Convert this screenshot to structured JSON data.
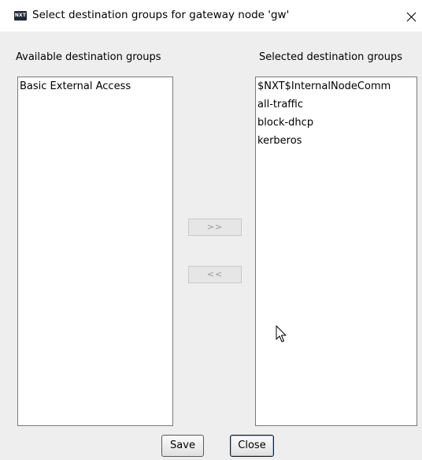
{
  "window": {
    "title": "Select destination groups for gateway node 'gw'",
    "app_icon_text": "NXT",
    "close_glyph": "✕"
  },
  "available": {
    "label": "Available destination groups",
    "items": [
      "Basic External Access"
    ]
  },
  "selected": {
    "label": "Selected destination groups",
    "items": [
      "$NXT$InternalNodeComm",
      "all-traffic",
      "block-dhcp",
      "kerberos"
    ]
  },
  "buttons": {
    "add": ">>",
    "remove": "<<",
    "save": "Save",
    "close": "Close"
  },
  "icons": {
    "app": "nxt-app-icon",
    "close": "close-icon",
    "cursor": "mouse-pointer-icon"
  },
  "colors": {
    "client_bg": "#eeeeee",
    "list_bg": "#ffffff",
    "disabled_text": "#9a9a9a",
    "focus_ring": "#9fbfe6"
  }
}
